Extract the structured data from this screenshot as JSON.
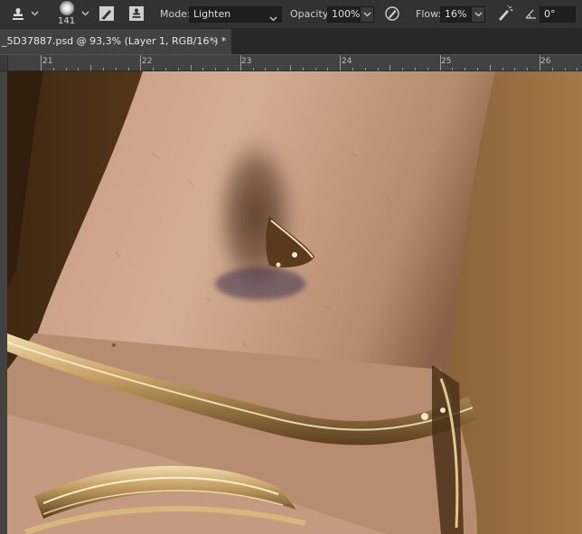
{
  "optionsBar": {
    "tool_icon": "clone-stamp-icon",
    "brush_size": "141",
    "mode_label": "Mode:",
    "mode_value": "Lighten",
    "opacity_label": "Opacity:",
    "opacity_value": "100%",
    "flow_label": "Flow:",
    "flow_value": "16%",
    "angle_value": "0°"
  },
  "document": {
    "tab_title": "_5D37887.psd @ 93,3% (Layer 1, RGB/16*) *",
    "close_glyph": "×"
  },
  "ruler": {
    "ticks": [
      "21",
      "22",
      "23",
      "24",
      "25",
      "26"
    ]
  },
  "canvas": {
    "subject": "close-up photo of forearm with gold bangle bracelets",
    "colors": {
      "background": "#5b3a1c",
      "skin": "#c8a085",
      "gold": "#d6b67b",
      "shadow": "#6b4a36"
    }
  }
}
